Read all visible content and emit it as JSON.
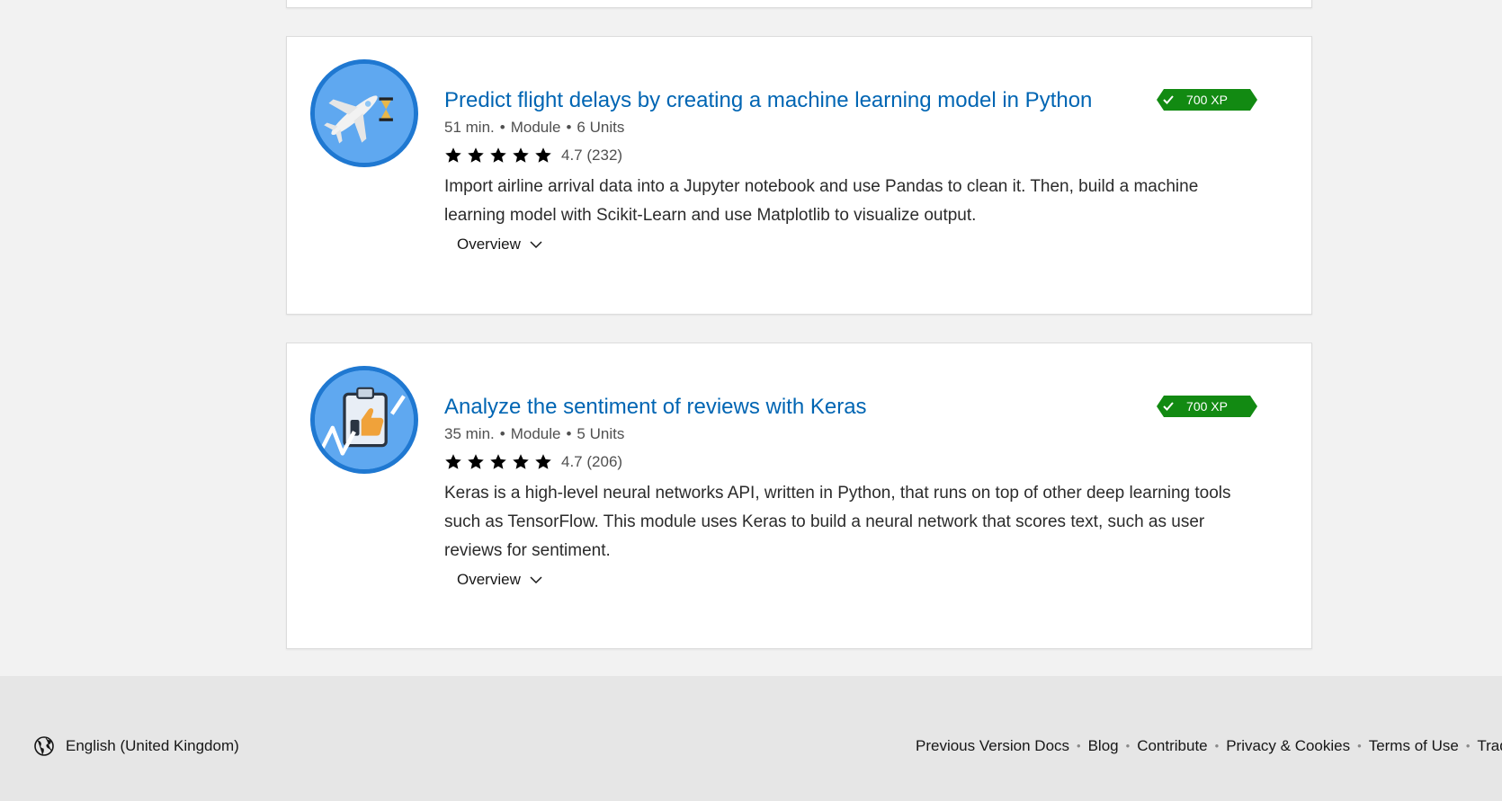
{
  "modules": [
    {
      "title": "Predict flight delays by creating a machine learning model in Python",
      "duration": "51 min.",
      "type": "Module",
      "units": "6 Units",
      "rating": "4.7",
      "rating_count": "(232)",
      "stars": 5,
      "xp": "700 XP",
      "description": "Import airline arrival data into a Jupyter notebook and use Pandas to clean it. Then, build a machine learning model with Scikit-Learn and use Matplotlib to visualize output.",
      "overview_label": "Overview",
      "icon": "airplane-hourglass-icon"
    },
    {
      "title": "Analyze the sentiment of reviews with Keras",
      "duration": "35 min.",
      "type": "Module",
      "units": "5 Units",
      "rating": "4.7",
      "rating_count": "(206)",
      "stars": 5,
      "xp": "700 XP",
      "description": "Keras is a high-level neural networks API, written in Python, that runs on top of other deep learning tools such as TensorFlow. This module uses Keras to build a neural network that scores text, such as user reviews for sentiment.",
      "overview_label": "Overview",
      "icon": "clipboard-thumbs-up-icon"
    }
  ],
  "footer": {
    "locale": "English (United Kingdom)",
    "links": [
      "Previous Version Docs",
      "Blog",
      "Contribute",
      "Privacy & Cookies",
      "Terms of Use",
      "Trademarks"
    ]
  },
  "colors": {
    "title_link": "#0065b3",
    "xp_badge": "#128a12",
    "badge_ring": "#1f78d1",
    "page_bg": "#f2f2f2",
    "footer_bg": "#e6e6e6"
  }
}
